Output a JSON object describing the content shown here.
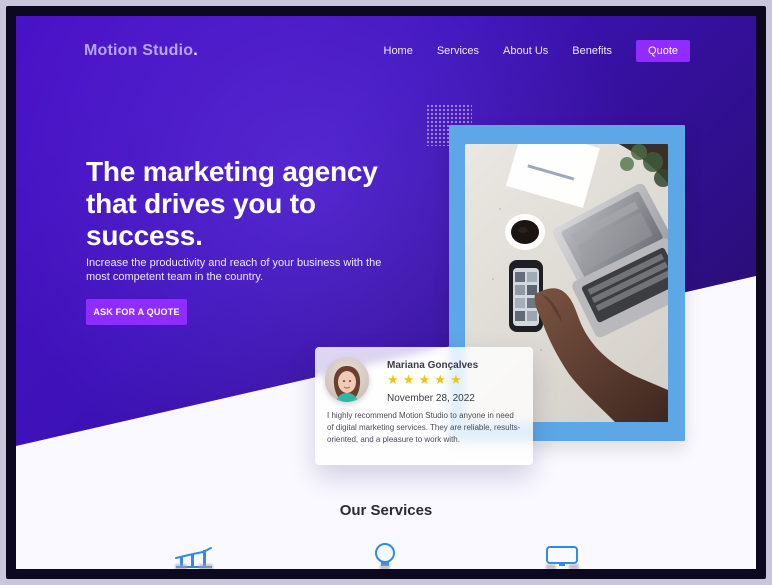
{
  "header": {
    "brand": "Motion Studio",
    "brand_dot": ".",
    "nav": {
      "items": [
        "Home",
        "Services",
        "About Us",
        "Benefits"
      ],
      "quote_label": "Quote"
    }
  },
  "hero": {
    "title": "The marketing agency that drives you to success.",
    "subtitle": "Increase the productivity and reach of your business with the most competent team in the country.",
    "cta_label": "ASK FOR A  QUOTE"
  },
  "review": {
    "name": "Mariana Gonçalves",
    "stars": "★ ★ ★ ★ ★",
    "date": "November 28, 2022",
    "text": "I highly recommend Motion Studio to anyone in need of digital marketing services. They are reliable, results-oriented, and a pleasure to work with."
  },
  "services": {
    "title": "Our Services"
  },
  "colors": {
    "accent": "#8f2cff",
    "hero_start": "#4b12c8",
    "hero_end": "#1f0b4f",
    "photo_frame": "#5da7e7",
    "stars": "#f1c40f",
    "services_icon": "#2f8be6"
  },
  "icons": {
    "service_left": "chart-icon",
    "service_mid": "lightbulb-icon",
    "service_right": "monitor-icon"
  }
}
